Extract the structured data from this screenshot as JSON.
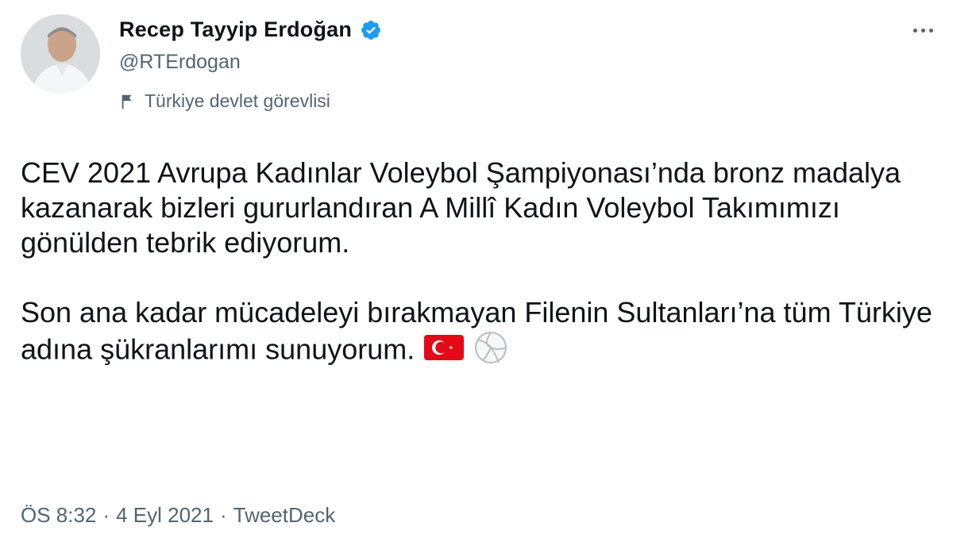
{
  "author": {
    "name": "Recep Tayyip Erdoğan",
    "handle": "@RTErdogan",
    "verified": true,
    "label": "Türkiye devlet görevlisi"
  },
  "tweet": {
    "paragraph_1": "CEV 2021 Avrupa Kadınlar Voleybol Şampiyonası’nda bronz madalya kazanarak bizleri gururlandıran A Millî Kadın Voleybol Takımımızı gönülden tebrik ediyorum.",
    "paragraph_2": "Son ana kadar mücadeleyi bırakmayan Filenin Sultanları’na tüm Türkiye adına şükranlarımı sunuyorum.",
    "emojis": [
      "turkey-flag",
      "volleyball"
    ]
  },
  "meta": {
    "time": "ÖS 8:32",
    "sep1": "·",
    "date": "4 Eyl 2021",
    "sep2": "·",
    "source": "TweetDeck"
  },
  "colors": {
    "text": "#0f1419",
    "secondary": "#536471",
    "verified": "#1d9bf0",
    "flag_red": "#e30a17"
  }
}
